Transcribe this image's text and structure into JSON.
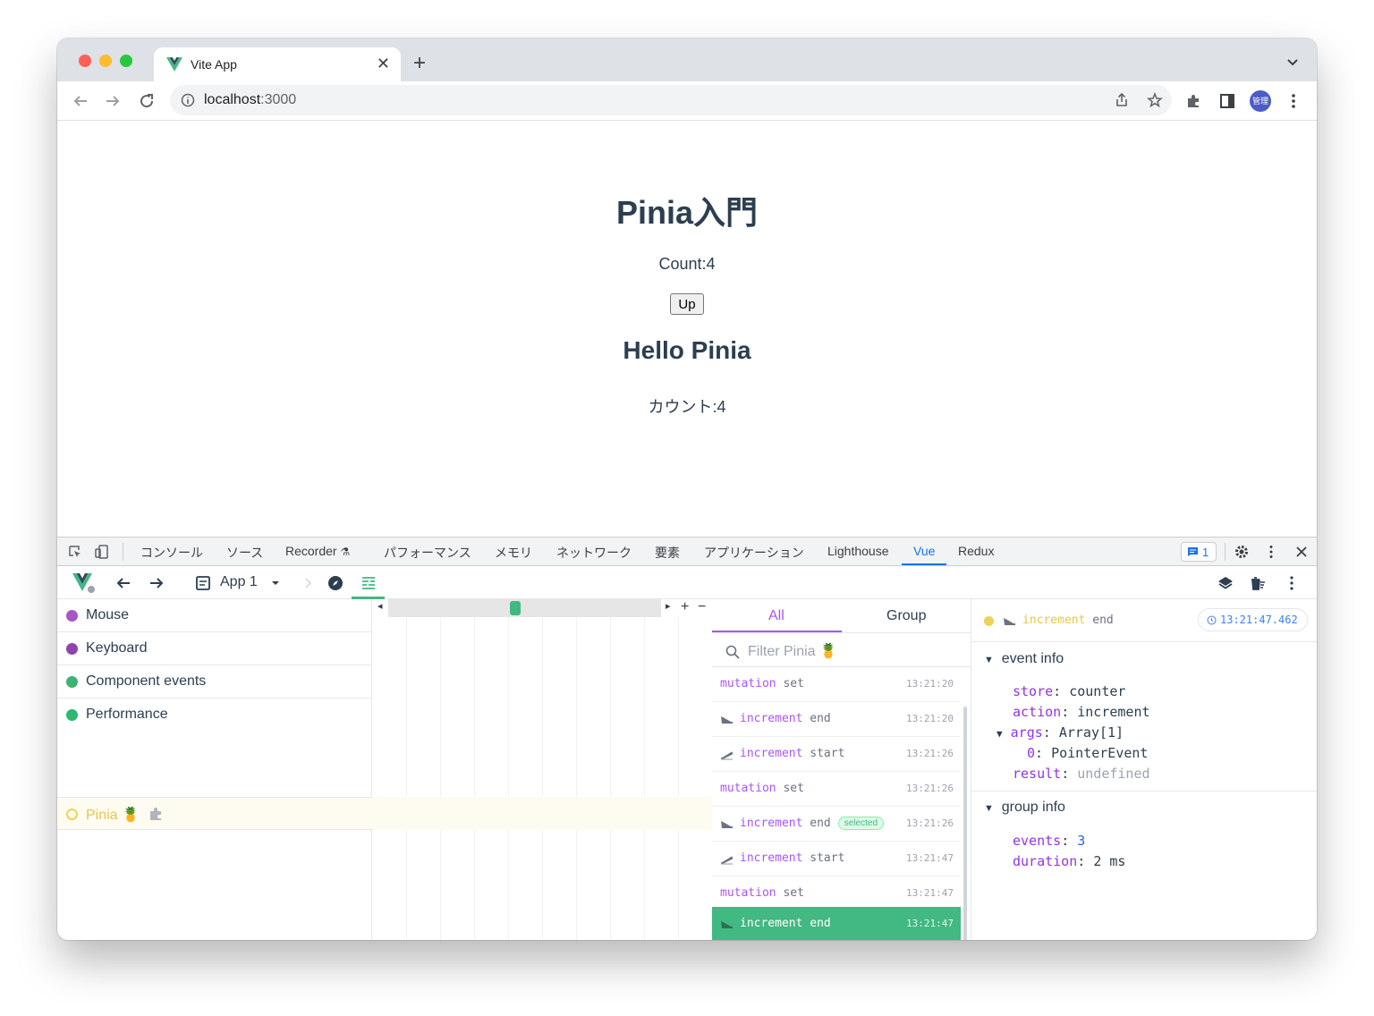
{
  "browser": {
    "tab_title": "Vite App",
    "url_host": "localhost",
    "url_port": ":3000",
    "profile_label": "管理"
  },
  "page": {
    "title": "Pinia入門",
    "count_text": "Count:4",
    "up_button": "Up",
    "subtitle": "Hello Pinia",
    "kana_count_text": "カウント:4"
  },
  "devtools": {
    "tabs": [
      "コンソール",
      "ソース",
      "Recorder",
      "パフォーマンス",
      "メモリ",
      "ネットワーク",
      "要素",
      "アプリケーション",
      "Lighthouse",
      "Vue",
      "Redux"
    ],
    "active_tab": "Vue",
    "issues_count": "1"
  },
  "vue": {
    "app_selector": "App 1",
    "layers": [
      "Mouse",
      "Keyboard",
      "Component events",
      "Performance"
    ],
    "layer_colors": [
      "#a855c8",
      "#8e44ad",
      "#3cb371",
      "#2eb872"
    ],
    "pinia_layer": "Pinia 🍍",
    "event_tabs": {
      "all": "All",
      "group": "Group"
    },
    "filter_placeholder": "Filter Pinia 🍍",
    "events": [
      {
        "title": "mutation",
        "sub": "set",
        "time": "13:21:20",
        "icon": "none"
      },
      {
        "title": "increment",
        "sub": "end",
        "time": "13:21:20",
        "icon": "landing-plane-icon"
      },
      {
        "title": "increment",
        "sub": "start",
        "time": "13:21:26",
        "icon": "takeoff-plane-icon"
      },
      {
        "title": "mutation",
        "sub": "set",
        "time": "13:21:26",
        "icon": "none"
      },
      {
        "title": "increment",
        "sub": "end",
        "time": "13:21:26",
        "icon": "landing-plane-icon",
        "badge": "selected"
      },
      {
        "title": "increment",
        "sub": "start",
        "time": "13:21:47",
        "icon": "takeoff-plane-icon"
      },
      {
        "title": "mutation",
        "sub": "set",
        "time": "13:21:47",
        "icon": "none"
      },
      {
        "title": "increment",
        "sub": "end",
        "time": "13:21:47",
        "icon": "landing-plane-icon",
        "selected": true
      }
    ],
    "details": {
      "title": "increment",
      "sub": "end",
      "time": "13:21:47.462",
      "event_info_title": "event info",
      "store_key": "store",
      "store_val": "counter",
      "action_key": "action",
      "action_val": "increment",
      "args_key": "args",
      "args_val": "Array[1]",
      "arg0_key": "0",
      "arg0_val": "PointerEvent",
      "result_key": "result",
      "result_val": "undefined",
      "group_info_title": "group info",
      "events_key": "events",
      "events_val": "3",
      "duration_key": "duration",
      "duration_val": "2 ms"
    }
  },
  "colors": {
    "vue_green": "#42b883",
    "pinia_yellow": "#ecd35a",
    "accent_purple": "#a855f7",
    "devtools_blue": "#1a73e8"
  }
}
